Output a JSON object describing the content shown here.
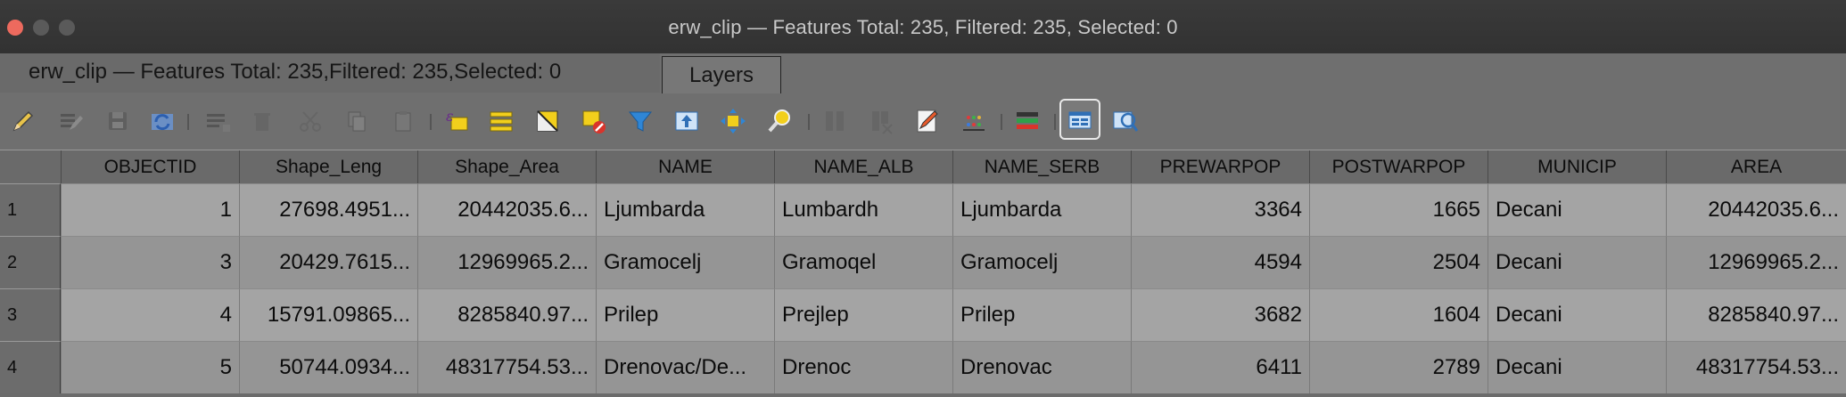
{
  "window": {
    "title": "erw_clip — Features Total: 235, Filtered: 235, Selected: 0"
  },
  "tabs": [
    {
      "label": "erw_clip — Features Total: 235,Filtered: 235,Selected: 0",
      "active": true
    },
    {
      "label": "Layers",
      "active": false
    }
  ],
  "toolbar": {
    "buttons": [
      {
        "icon": "pencil-edit-icon"
      },
      {
        "icon": "multi-edit-icon"
      },
      {
        "icon": "save-edits-icon"
      },
      {
        "icon": "reload-icon"
      },
      {
        "icon": "add-feature-icon"
      },
      {
        "icon": "delete-feature-icon"
      },
      {
        "icon": "cut-icon"
      },
      {
        "icon": "copy-icon"
      },
      {
        "icon": "paste-icon"
      },
      {
        "icon": "select-by-expression-icon"
      },
      {
        "icon": "select-all-icon"
      },
      {
        "icon": "invert-selection-icon"
      },
      {
        "icon": "deselect-all-icon"
      },
      {
        "icon": "filter-icon"
      },
      {
        "icon": "move-selection-to-top-icon"
      },
      {
        "icon": "pan-to-selection-icon"
      },
      {
        "icon": "zoom-to-selection-icon"
      },
      {
        "icon": "new-field-icon"
      },
      {
        "icon": "delete-field-icon"
      },
      {
        "icon": "field-calculator-icon"
      },
      {
        "icon": "conditional-formatting-icon"
      },
      {
        "icon": "actions-icon"
      },
      {
        "icon": "dock-table-icon"
      },
      {
        "icon": "form-view-icon"
      }
    ]
  },
  "table": {
    "columns": [
      "OBJECTID",
      "Shape_Leng",
      "Shape_Area",
      "NAME",
      "NAME_ALB",
      "NAME_SERB",
      "PREWARPOP",
      "POSTWARPOP",
      "MUNICIP",
      "AREA"
    ],
    "rows": [
      {
        "rownum": "1",
        "cells": [
          "1",
          "27698.4951...",
          "20442035.6...",
          "Ljumbarda",
          "Lumbardh",
          "Ljumbarda",
          "3364",
          "1665",
          "Decani",
          "20442035.6..."
        ]
      },
      {
        "rownum": "2",
        "cells": [
          "3",
          "20429.7615...",
          "12969965.2...",
          "Gramocelj",
          "Gramoqel",
          "Gramocelj",
          "4594",
          "2504",
          "Decani",
          "12969965.2..."
        ]
      },
      {
        "rownum": "3",
        "cells": [
          "4",
          "15791.09865...",
          "8285840.97...",
          "Prilep",
          "Prejlep",
          "Prilep",
          "3682",
          "1604",
          "Decani",
          "8285840.97..."
        ]
      },
      {
        "rownum": "4",
        "cells": [
          "5",
          "50744.0934...",
          "48317754.53...",
          "Drenovac/De...",
          "Drenoc",
          "Drenovac",
          "6411",
          "2789",
          "Decani",
          "48317754.53..."
        ]
      }
    ]
  },
  "colors": {
    "close": "#ed6a5e",
    "row_odd": "#a4a4a4",
    "row_even": "#959595"
  }
}
